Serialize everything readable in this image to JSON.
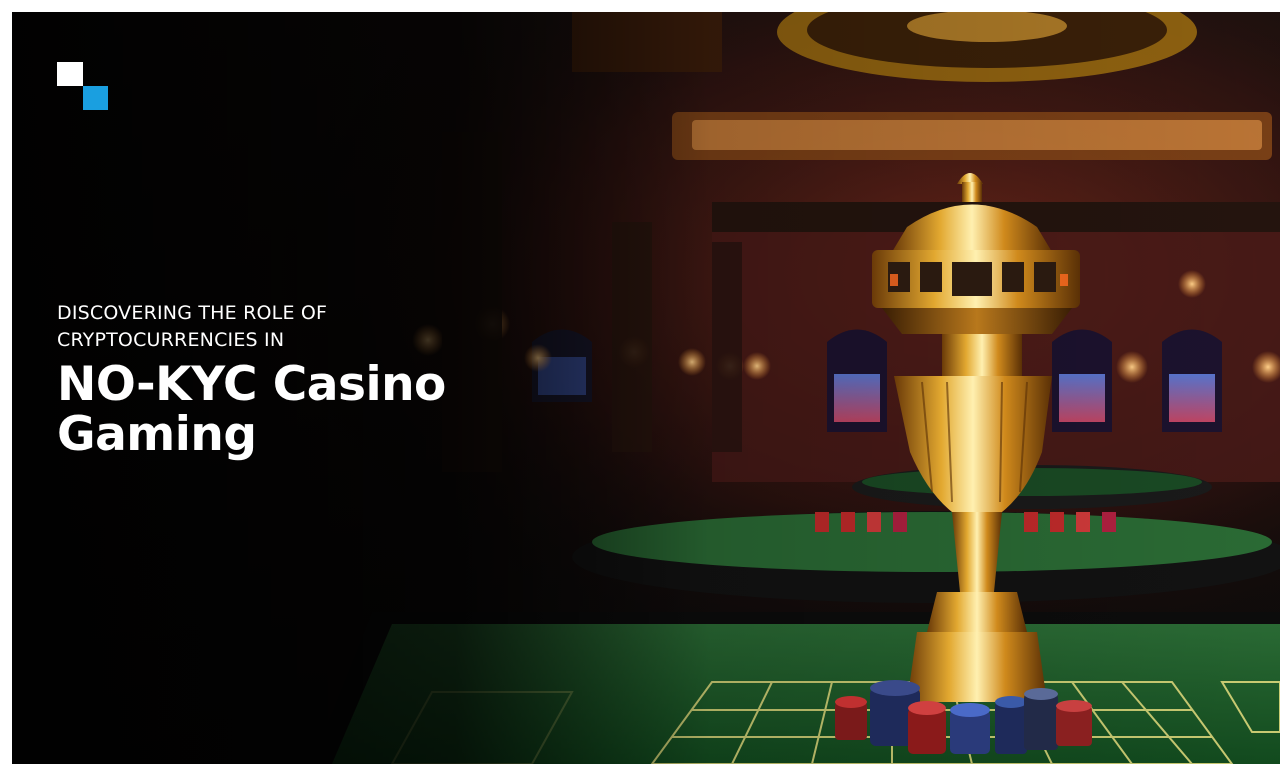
{
  "banner": {
    "kicker_line_1": "DISCOVERING THE ROLE OF",
    "kicker_line_2": "CRYPTOCURRENCIES IN",
    "title_line_1": "NO-KYC Casino",
    "title_line_2": "Gaming"
  },
  "colors": {
    "logo_primary": "#ffffff",
    "logo_accent": "#1a9fe0",
    "text": "#ffffff",
    "table_felt": "#1e5a2a",
    "trophy_gold": "#c8901c"
  },
  "icons": [
    "brand-logo-icon"
  ]
}
